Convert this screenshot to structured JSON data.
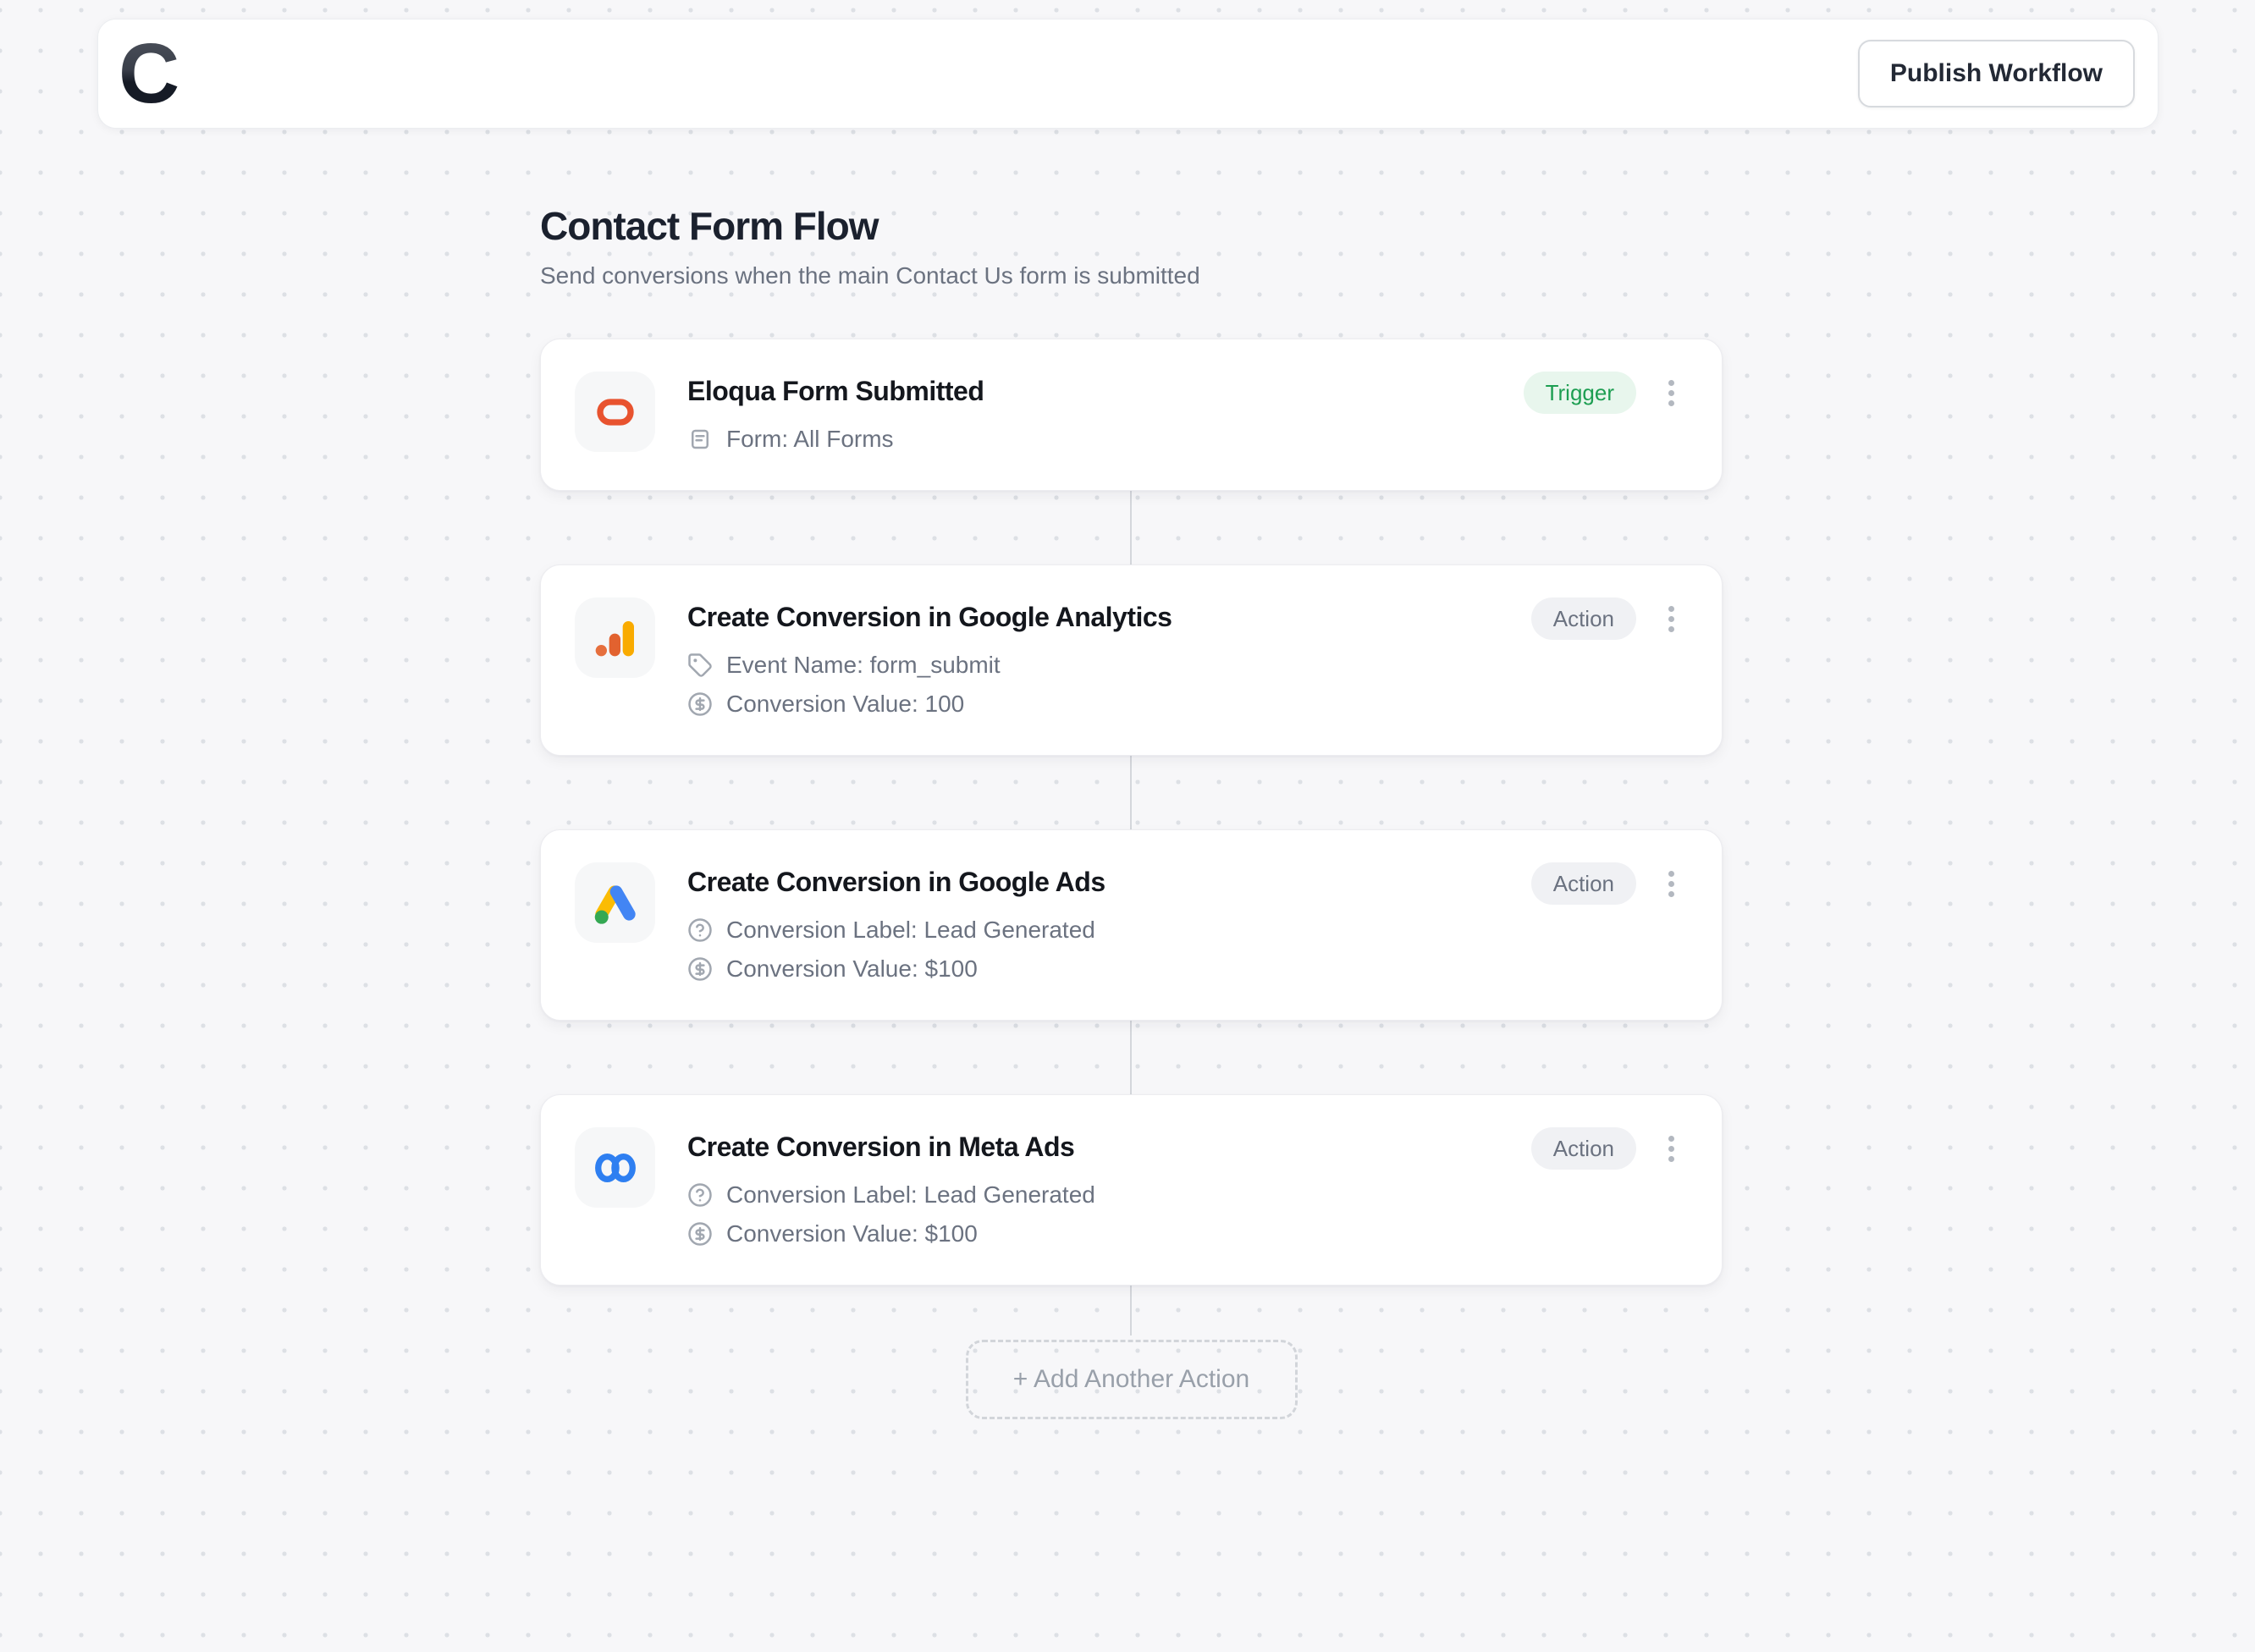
{
  "header": {
    "logo_letter": "C",
    "publish_button_label": "Publish Workflow"
  },
  "page": {
    "title": "Contact Form Flow",
    "subtitle": "Send conversions when the main Contact Us form is submitted"
  },
  "flow": {
    "nodes": [
      {
        "title": "Eloqua Form Submitted",
        "badge": "Trigger",
        "icon": "eloqua-icon",
        "details": [
          {
            "icon": "form-icon",
            "text": "Form: All Forms"
          }
        ]
      },
      {
        "title": "Create Conversion in Google Analytics",
        "badge": "Action",
        "icon": "google-analytics-icon",
        "details": [
          {
            "icon": "tag-icon",
            "text": "Event Name: form_submit"
          },
          {
            "icon": "dollar-circle-icon",
            "text": "Conversion Value: 100"
          }
        ]
      },
      {
        "title": "Create Conversion in Google Ads",
        "badge": "Action",
        "icon": "google-ads-icon",
        "details": [
          {
            "icon": "question-circle-icon",
            "text": "Conversion Label: Lead Generated"
          },
          {
            "icon": "dollar-circle-icon",
            "text": "Conversion Value: $100"
          }
        ]
      },
      {
        "title": "Create Conversion in Meta Ads",
        "badge": "Action",
        "icon": "meta-icon",
        "details": [
          {
            "icon": "question-circle-icon",
            "text": "Conversion Label: Lead Generated"
          },
          {
            "icon": "dollar-circle-icon",
            "text": "Conversion Value: $100"
          }
        ]
      }
    ],
    "add_action_label": "+ Add Another Action"
  },
  "colors": {
    "trigger_badge_bg": "#e8f6ed",
    "trigger_badge_text": "#1d9e52",
    "action_badge_bg": "#f0f1f4",
    "action_badge_text": "#6b7280",
    "eloqua_orange": "#e8532f",
    "ga_gold": "#f9ab00",
    "ga_orange": "#e2622f",
    "ga_orange_light": "#e66f3d",
    "ads_blue": "#4285f4",
    "ads_yellow": "#fbbc04",
    "ads_green": "#34a853",
    "meta_blue": "#2e7ff1"
  }
}
